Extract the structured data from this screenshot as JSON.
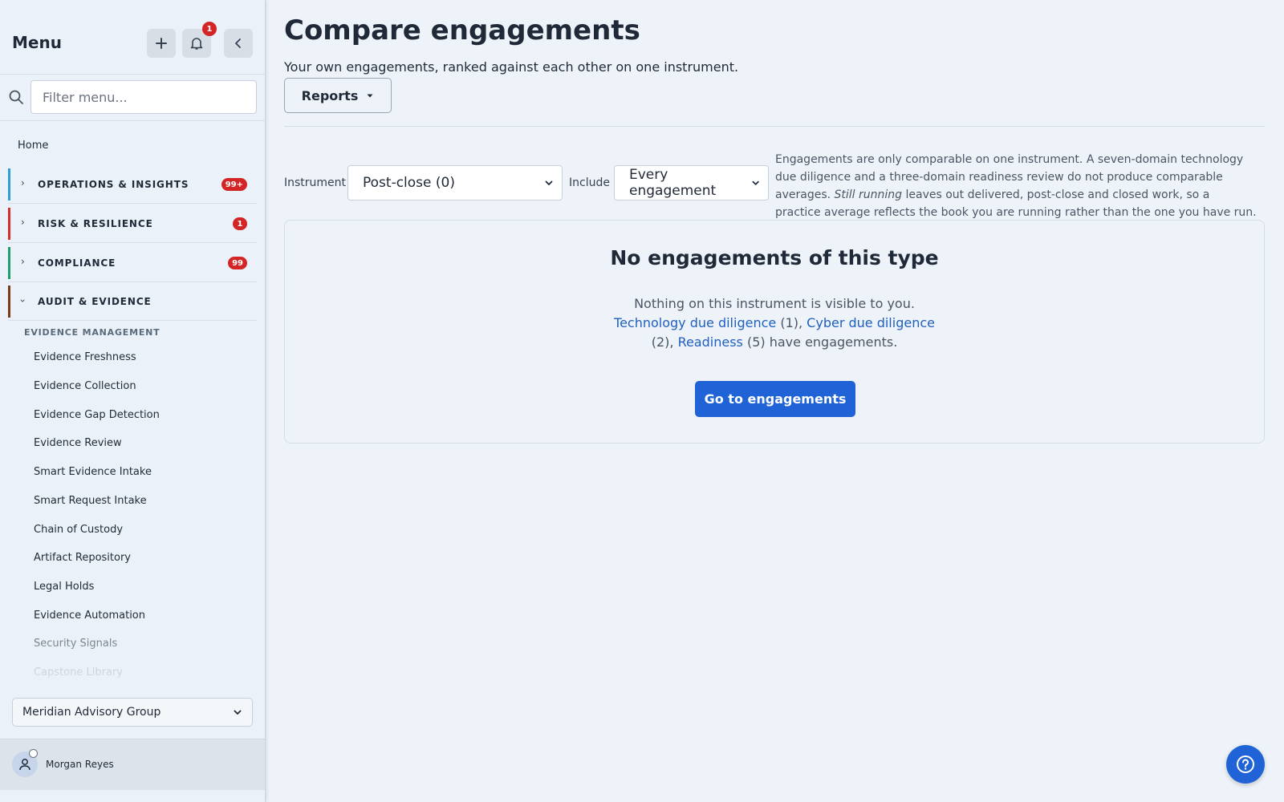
{
  "sidebar": {
    "title": "Menu",
    "notification_count": "1",
    "filter_placeholder": "Filter menu...",
    "home": "Home",
    "sections": [
      {
        "label": "OPERATIONS & INSIGHTS",
        "badge": "99+",
        "accent": "#2a9fd6",
        "expanded": false
      },
      {
        "label": "RISK & RESILIENCE",
        "badge": "1",
        "accent": "#d32f2f",
        "expanded": false
      },
      {
        "label": "COMPLIANCE",
        "badge": "99",
        "accent": "#1f9d6b",
        "expanded": false
      },
      {
        "label": "AUDIT & EVIDENCE",
        "badge": "",
        "accent": "#7a3b1c",
        "expanded": true
      }
    ],
    "group_label": "EVIDENCE MANAGEMENT",
    "items": [
      "Evidence Freshness",
      "Evidence Collection",
      "Evidence Gap Detection",
      "Evidence Review",
      "Smart Evidence Intake",
      "Smart Request Intake",
      "Chain of Custody",
      "Artifact Repository",
      "Legal Holds",
      "Evidence Automation",
      "Security Signals",
      "Capstone Library"
    ],
    "organization": "Meridian Advisory Group",
    "user_name": "Morgan Reyes"
  },
  "main": {
    "title": "Compare engagements",
    "subtitle": "Your own engagements, ranked against each other on one instrument.",
    "reports_label": "Reports",
    "instrument_label": "Instrument",
    "instrument_value": "Post-close (0)",
    "include_label": "Include",
    "include_value": "Every engagement",
    "help_line1": "Engagements are only comparable on one instrument. A seven-domain technology due diligence and a three-domain readiness review do not produce comparable averages.",
    "help_emph": "Still running",
    "help_line2": "leaves out delivered, post-close and closed work, so a practice average reflects the book you are running rather than the one you have run.",
    "empty_title": "No engagements of this type",
    "empty_line1": "Nothing on this instrument is visible to you.",
    "link_tdd": "Technology due diligence",
    "count_tdd": "(1),",
    "link_cdd": "Cyber due diligence",
    "count_cdd": "(2),",
    "link_ready": "Readiness",
    "count_ready": "(5) have engagements.",
    "go_button": "Go to engagements"
  },
  "colors": {
    "accent_blue": "#1f63d6",
    "badge_red": "#d32525",
    "link_blue": "#1f5fbf"
  }
}
